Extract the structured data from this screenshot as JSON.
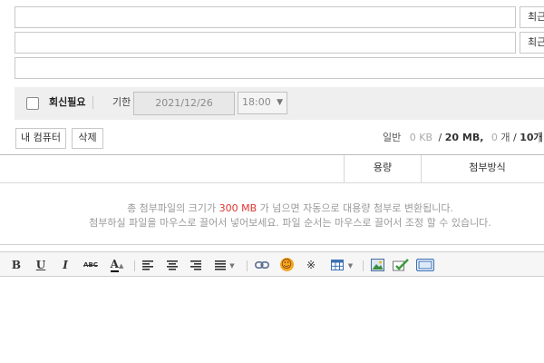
{
  "recipients": {
    "row1_button": "최근",
    "row2_button": "최근"
  },
  "options": {
    "reply_required_label": "회신필요",
    "deadline_label": "기한",
    "deadline_date": "2021/12/26",
    "deadline_time": "18:00"
  },
  "attachments": {
    "my_computer_button": "내 컴퓨터",
    "delete_button": "삭제",
    "normal_label": "일반",
    "used_size": "0 KB",
    "max_size_sep": "/",
    "max_size": "20 MB,",
    "file_count": "0",
    "file_count_unit": "개",
    "file_count_sep": "/",
    "max_count": "10개",
    "col_size": "용량",
    "col_method": "첨부방식",
    "notice_line1_pre": "총 첨부파일의 크기가",
    "notice_line1_highlight": "300 MB",
    "notice_line1_post": "가 넘으면 자동으로 대용량 첨부로 변환됩니다.",
    "notice_line2": "첨부하실 파일을 마우스로 끌어서 넣어보세요. 파일 순서는 마우스로 끌어서 조정 할 수 있습니다."
  },
  "editor_toolbar": {
    "bold": "B",
    "underline": "U",
    "italic": "I",
    "strike": "ABC",
    "font_color": "A",
    "emoticon": "☺",
    "special_char": "※"
  },
  "colors": {
    "highlight": "#e0332e",
    "bar_bg": "#efefef"
  }
}
